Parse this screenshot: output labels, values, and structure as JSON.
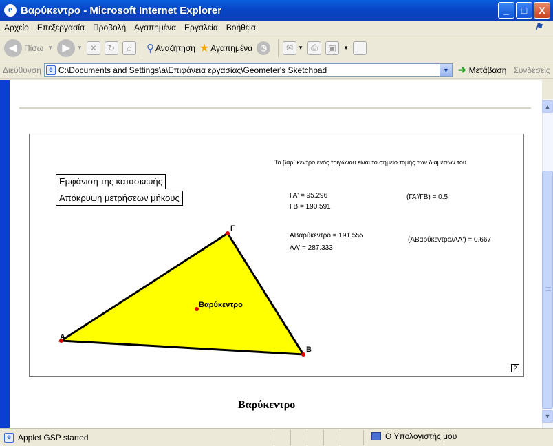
{
  "window": {
    "title": "Βαρύκεντρο - Microsoft Internet Explorer",
    "controls": [
      "_",
      "□",
      "X"
    ]
  },
  "menu": [
    "Αρχείο",
    "Επεξεργασία",
    "Προβολή",
    "Αγαπημένα",
    "Εργαλεία",
    "Βοήθεια"
  ],
  "toolbar": {
    "back_label": "Πίσω",
    "search_label": "Αναζήτηση",
    "favorites_label": "Αγαπημένα"
  },
  "address": {
    "label": "Διεύθυνση",
    "url": "C:\\Documents and Settings\\a\\Επιφάνεια εργασίας\\Geometer's Sketchpad",
    "go_label": "Μετάβαση",
    "links_label": "Συνδέσεις"
  },
  "applet": {
    "description": "Το βαρύκεντρο ενός τριγώνου είναι το σημείο τομής των διαμέσων του.",
    "show_button": "Εμφάνιση της κατασκευής",
    "hide_button": "Απόκρυψη μετρήσεων μήκους",
    "measurements": {
      "ga_prime": "ΓΑ' = 95.296",
      "gb": "ΓΒ = 190.591",
      "ratio1": "(ΓΑ'/ΓΒ) = 0.5",
      "abary": "ΑΒαρύκεντρο = 191.555",
      "aa_prime": "ΑΑ' = 287.333",
      "ratio2": "(ΑΒαρύκεντρο/ΑΑ') = 0.667"
    },
    "points": {
      "a": "Α",
      "b": "Β",
      "g": "Γ",
      "centroid": "Βαρύκεντρο"
    },
    "help": "?",
    "triangle_fill": "#ffff00"
  },
  "page": {
    "heading": "Βαρύκεντρο"
  },
  "status": {
    "text": "Applet GSP started",
    "zone": "Ο Υπολογιστής μου"
  }
}
